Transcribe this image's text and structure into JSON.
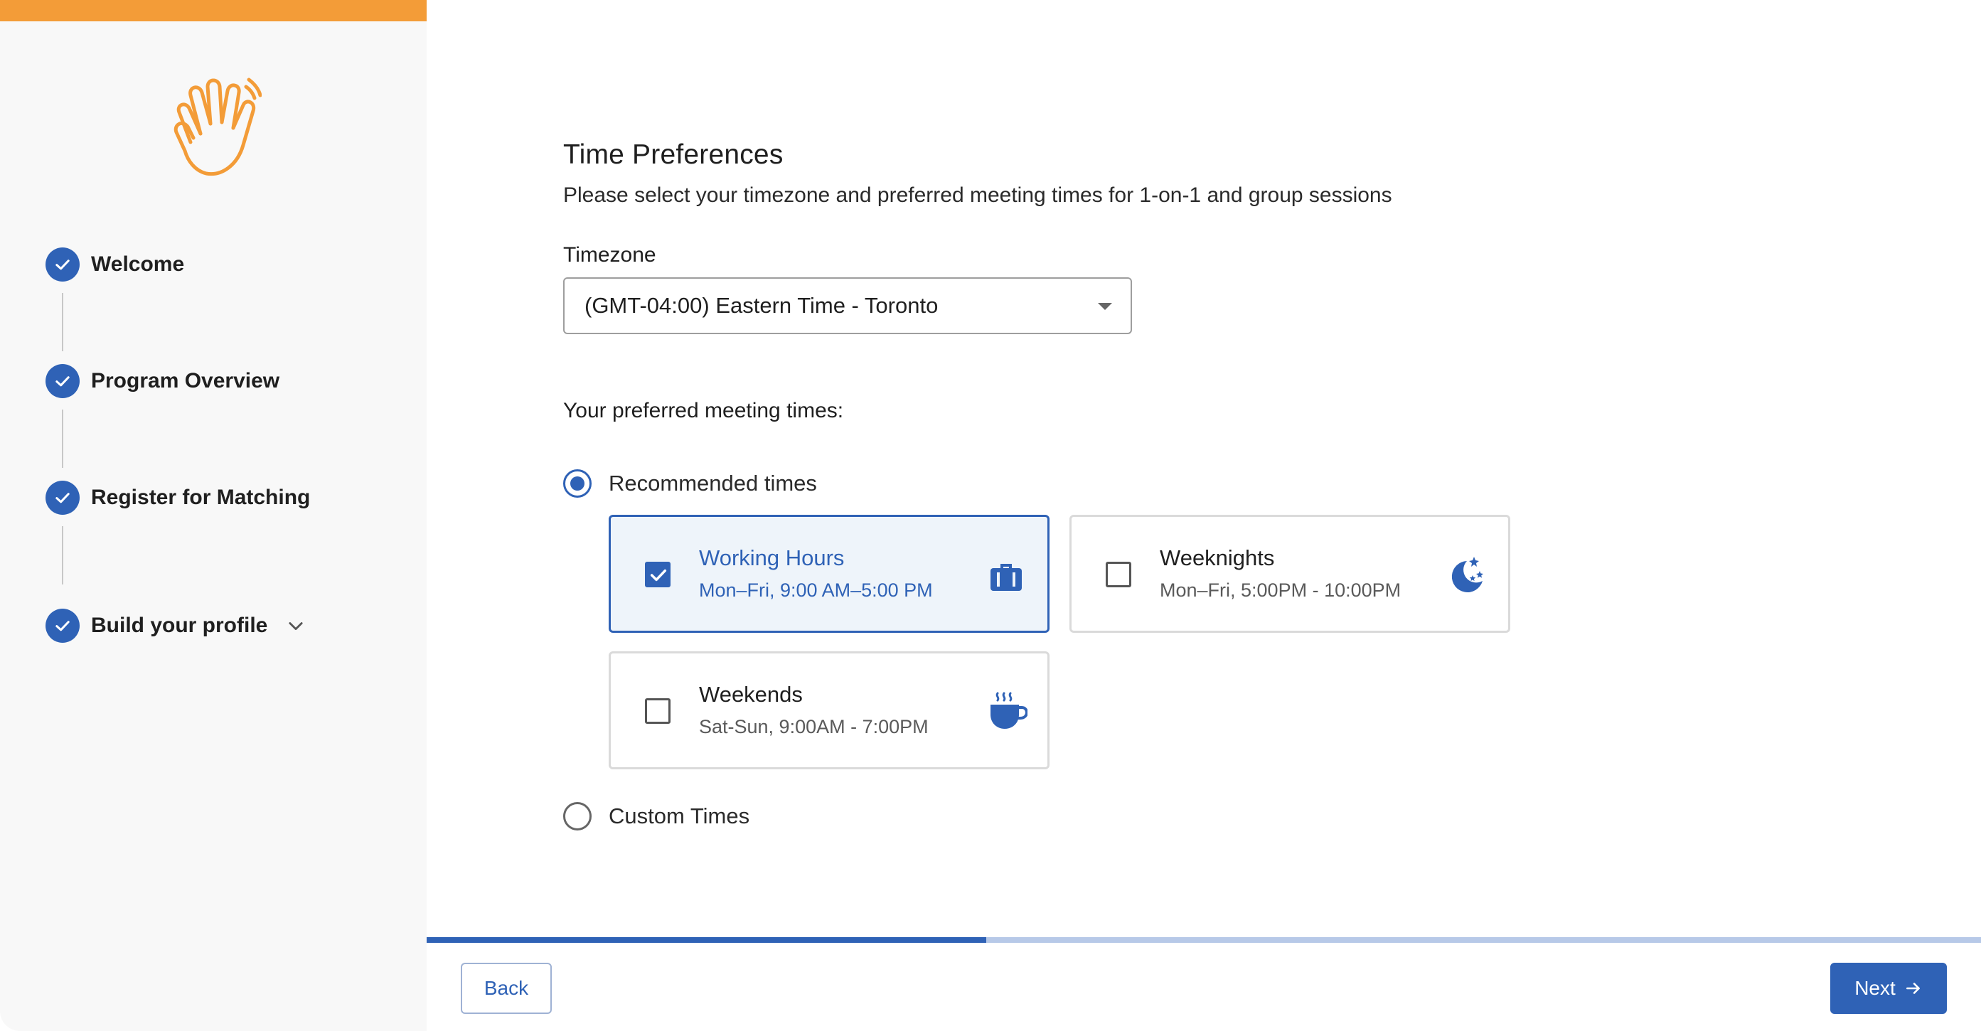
{
  "colors": {
    "accent": "#2f62b6",
    "brand_orange": "#f39c38",
    "sidebar_bg": "#f8f8f8",
    "selected_card_bg": "#eef4fa"
  },
  "sidebar": {
    "logo_icon": "waving-hand-icon",
    "steps": [
      {
        "label": "Welcome",
        "status": "completed"
      },
      {
        "label": "Program Overview",
        "status": "completed"
      },
      {
        "label": "Register for Matching",
        "status": "completed"
      },
      {
        "label": "Build your profile",
        "status": "completed",
        "expandable": true
      }
    ]
  },
  "main": {
    "title": "Time Preferences",
    "subtitle": "Please select your timezone and preferred meeting times for 1-on-1 and group sessions",
    "timezone": {
      "label": "Timezone",
      "selected": "(GMT-04:00) Eastern Time - Toronto"
    },
    "meeting_times_label": "Your preferred meeting times:",
    "options": {
      "recommended": {
        "label": "Recommended times",
        "selected": true
      },
      "custom": {
        "label": "Custom Times",
        "selected": false
      }
    },
    "cards": [
      {
        "title": "Working Hours",
        "subtitle": "Mon–Fri, 9:00 AM–5:00 PM",
        "checked": true,
        "icon": "briefcase-icon"
      },
      {
        "title": "Weeknights",
        "subtitle": "Mon–Fri, 5:00PM - 10:00PM",
        "checked": false,
        "icon": "moon-stars-icon"
      },
      {
        "title": "Weekends",
        "subtitle": "Sat-Sun, 9:00AM - 7:00PM",
        "checked": false,
        "icon": "coffee-cup-icon"
      }
    ]
  },
  "progress": {
    "fraction": 0.36
  },
  "footer": {
    "back_label": "Back",
    "next_label": "Next"
  }
}
